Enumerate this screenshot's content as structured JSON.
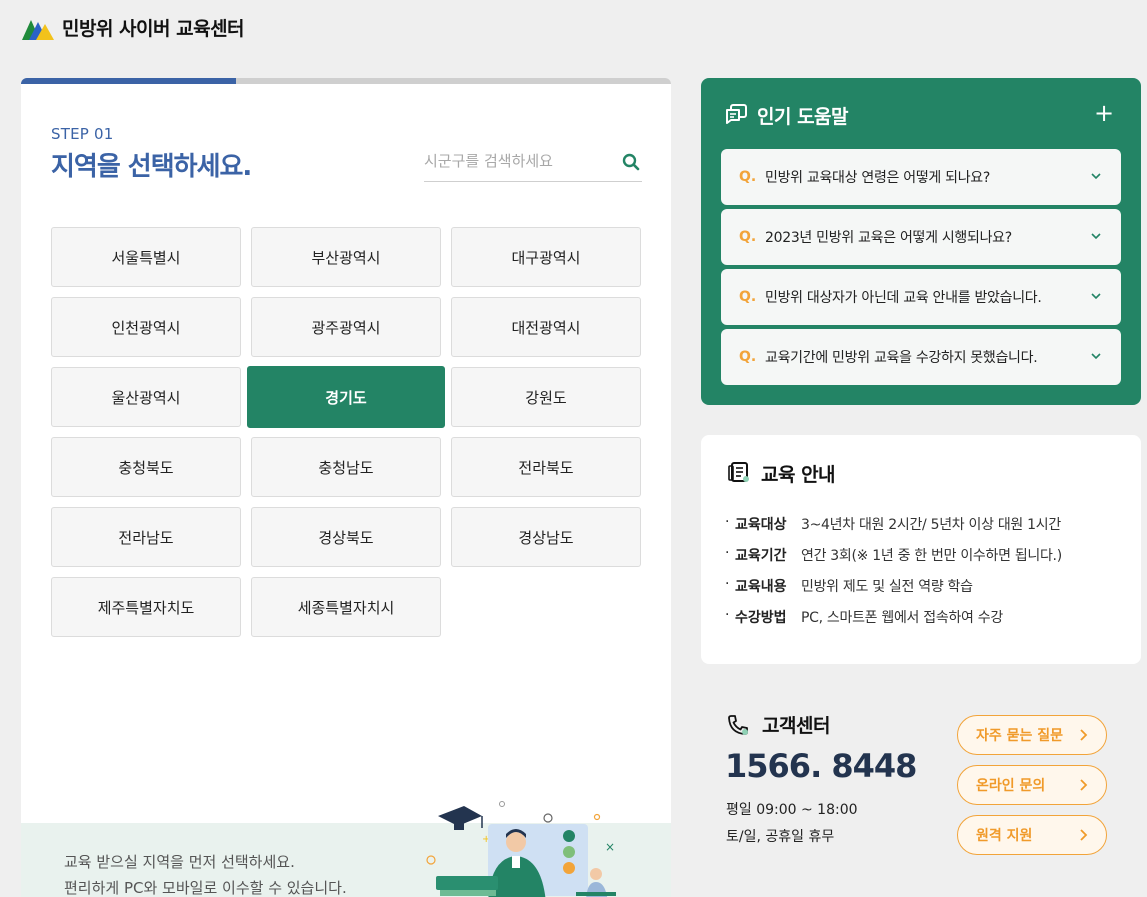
{
  "header": {
    "title": "민방위 사이버 교육센터",
    "logo_icon": "mountain-logo-icon"
  },
  "step": {
    "label": "STEP 01",
    "title": "지역을 선택하세요.",
    "progress": 0.33,
    "search": {
      "placeholder": "시군구를 검색하세요",
      "value": ""
    }
  },
  "regions": [
    "서울특별시",
    "부산광역시",
    "대구광역시",
    "인천광역시",
    "광주광역시",
    "대전광역시",
    "울산광역시",
    "경기도",
    "강원도",
    "충청북도",
    "충청남도",
    "전라북도",
    "전라남도",
    "경상북도",
    "경상남도",
    "제주특별자치도",
    "세종특별자치시"
  ],
  "selected_region": "경기도",
  "bottom_note": {
    "line1": "교육 받으실 지역을 먼저 선택하세요.",
    "line2": "편리하게 PC와 모바일로 이수할 수 있습니다."
  },
  "faq": {
    "title": "인기 도움말",
    "q_mark": "Q.",
    "items": [
      "민방위 교육대상 연령은 어떻게 되나요?",
      "2023년 민방위 교육은 어떻게 시행되나요?",
      "민방위 대상자가 아닌데 교육 안내를 받았습니다.",
      "교육기간에 민방위 교육을 수강하지 못했습니다."
    ]
  },
  "edu": {
    "title": "교육 안내",
    "rows": [
      {
        "key": "교육대상",
        "value": "3~4년차 대원 2시간/ 5년차 이상 대원 1시간"
      },
      {
        "key": "교육기간",
        "value": "연간 3회(※ 1년 중 한 번만 이수하면 됩니다.)"
      },
      {
        "key": "교육내용",
        "value": "민방위 제도 및 실전 역량 학습"
      },
      {
        "key": "수강방법",
        "value": "PC, 스마트폰 웹에서 접속하여 수강"
      }
    ]
  },
  "customer": {
    "title": "고객센터",
    "phone": "1566. 8448",
    "hours_weekday": "평일 09:00 ~ 18:00",
    "hours_weekend": "토/일, 공휴일 휴무",
    "buttons": [
      "자주 묻는 질문",
      "온라인 문의",
      "원격 지원"
    ]
  },
  "colors": {
    "brand_green": "#238465",
    "brand_blue": "#3b63a6",
    "accent_orange": "#f2a43a",
    "phone_navy": "#23344f"
  }
}
